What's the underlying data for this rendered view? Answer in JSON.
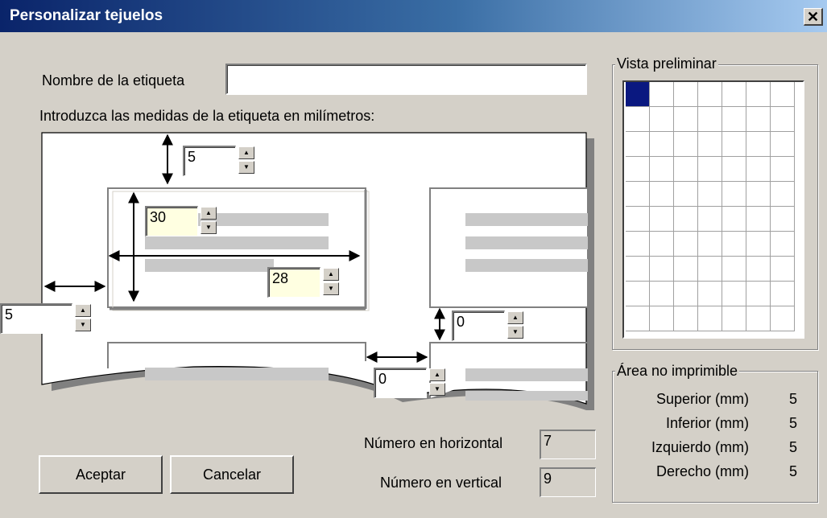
{
  "window": {
    "title": "Personalizar tejuelos",
    "close_glyph": "✕"
  },
  "name_label": "Nombre de la etiqueta",
  "name_value": "",
  "instructions": "Introduzca las medidas de la etiqueta en milímetros:",
  "measures": {
    "top_margin": "5",
    "label_height": "30",
    "label_width": "28",
    "left_margin": "5",
    "vertical_gap": "0",
    "horizontal_gap": "0"
  },
  "counts": {
    "horizontal_label": "Número en horizontal",
    "horizontal_value": "7",
    "vertical_label": "Número en vertical",
    "vertical_value": "9"
  },
  "buttons": {
    "ok": "Aceptar",
    "cancel": "Cancelar"
  },
  "preview": {
    "title": "Vista preliminar",
    "columns": 7,
    "rows": 10,
    "selected_color": "#0a1880"
  },
  "non_printable": {
    "title": "Área no imprimible",
    "rows": [
      {
        "label": "Superior (mm)",
        "value": "5"
      },
      {
        "label": "Inferior (mm)",
        "value": "5"
      },
      {
        "label": "Izquierdo (mm)",
        "value": "5"
      },
      {
        "label": "Derecho (mm)",
        "value": "5"
      }
    ]
  },
  "icons": {
    "spin_up": "▲",
    "spin_down": "▼"
  }
}
